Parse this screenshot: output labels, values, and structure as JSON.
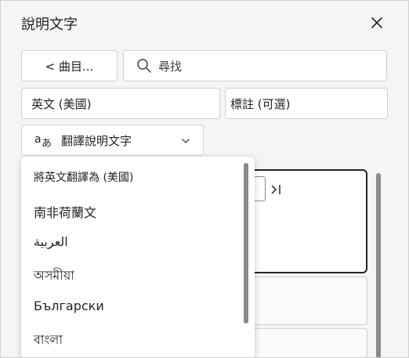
{
  "panel": {
    "title": "說明文字",
    "close_icon": "close-icon"
  },
  "toolbar": {
    "back_label": "< 曲目...",
    "search_placeholder": "尋找",
    "language_value": "英文 (美國)",
    "label_placeholder": "標註 (可選)",
    "translate_label": "翻譯說明文字"
  },
  "dropdown": {
    "options": [
      "將英文翻譯為 (美國)",
      "南非荷蘭文",
      "العربية",
      "অসমীয়া",
      "Български",
      "বাংলা"
    ]
  },
  "colors": {
    "pane_bg": "#f5f5f5",
    "control_bg": "#ffffff",
    "border": "#d1d1d1",
    "text": "#242424",
    "scrollbar": "#8a8a8a"
  }
}
